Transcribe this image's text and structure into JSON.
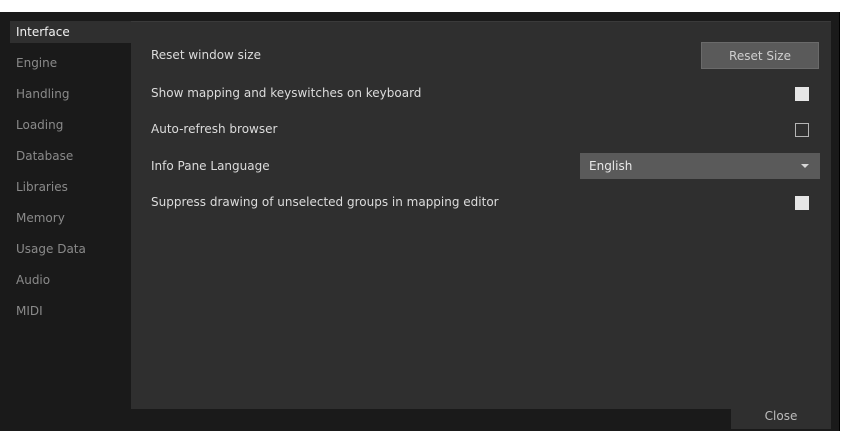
{
  "sidebar": {
    "items": [
      {
        "label": "Interface",
        "active": true
      },
      {
        "label": "Engine"
      },
      {
        "label": "Handling"
      },
      {
        "label": "Loading"
      },
      {
        "label": "Database"
      },
      {
        "label": "Libraries"
      },
      {
        "label": "Memory"
      },
      {
        "label": "Usage Data"
      },
      {
        "label": "Audio"
      },
      {
        "label": "MIDI"
      }
    ]
  },
  "settings": {
    "reset_window_size": {
      "label": "Reset window size",
      "button_label": "Reset Size"
    },
    "show_mapping": {
      "label": "Show mapping and keyswitches on keyboard",
      "checked": true
    },
    "auto_refresh": {
      "label": "Auto-refresh browser",
      "checked": false
    },
    "info_pane_language": {
      "label": "Info Pane Language",
      "selected": "English"
    },
    "suppress_drawing": {
      "label": "Suppress drawing of unselected groups in mapping editor",
      "checked": true
    }
  },
  "footer": {
    "close_label": "Close"
  }
}
